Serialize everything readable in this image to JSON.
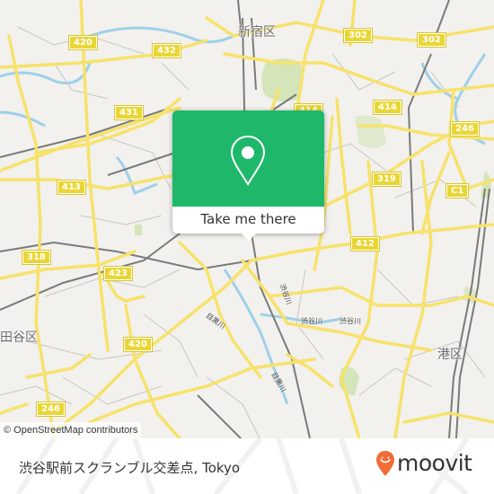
{
  "map": {
    "ward_labels": [
      "新宿区",
      "田谷区",
      "港区"
    ],
    "route_shields": [
      "420",
      "432",
      "302",
      "302",
      "414",
      "414",
      "246",
      "431",
      "413",
      "319",
      "C1",
      "412",
      "318",
      "423",
      "420",
      "246"
    ],
    "river_labels": [
      "目黒川",
      "目黒川",
      "渋谷川",
      "渋谷川",
      "渋谷川"
    ],
    "attribution": "© OpenStreetMap contributors",
    "colors": {
      "background": "#f2f1ed",
      "major_road": "#f7e26b",
      "river": "#9fd0ea",
      "park": "#cfe3b2",
      "rail": "#777777"
    }
  },
  "popup": {
    "icon": "map-pin-icon",
    "button_label": "Take me there",
    "accent": "#1fb86a"
  },
  "footer": {
    "place_name": "渋谷駅前スクランブル交差点, Tokyo",
    "logo_text": "moovit",
    "logo_color": "#f26b35"
  }
}
